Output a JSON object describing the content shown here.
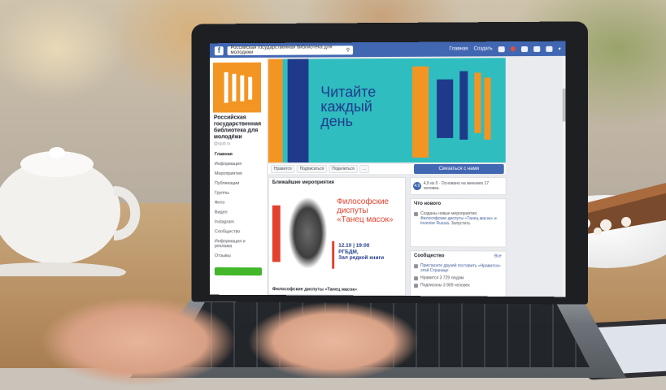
{
  "topbar": {
    "page_search": "Российская государственная библиотека для молодежи",
    "home": "Главная",
    "create": "Создать"
  },
  "sidebar": {
    "page_name": "Российская государственная библиотека для молодёжи",
    "handle": "@rgub.ru",
    "items": [
      "Главная",
      "Информация",
      "Мероприятия",
      "Публикации",
      "Группы",
      "Фото",
      "Видео",
      "Instagram",
      "Сообщество",
      "Информация и реклама",
      "Отзывы"
    ]
  },
  "cover": {
    "text_line1": "Читайте",
    "text_line2": "каждый",
    "text_line3": "день"
  },
  "cover_actions": {
    "like": "Нравится",
    "follow": "Подписаться",
    "share": "Поделиться",
    "more": "...",
    "message": "Связаться с нами"
  },
  "events": {
    "heading": "Ближайшие мероприятия",
    "poster_title_1": "Философские",
    "poster_title_2": "диспуты",
    "poster_title_3": "«Танец масок»",
    "poster_date": "12.10 | 19:00",
    "poster_org": "РГБДМ,",
    "poster_hall": "Зал редкой книги",
    "footer": "Философские диспуты «Танец масок»"
  },
  "rating": {
    "score": "4.9",
    "text": "4,9 из 5 · Основано на мнениях 17 человек."
  },
  "news": {
    "heading": "Что нового",
    "text_prefix": "Созданы новые мероприятия:",
    "text_link": "Философские диспуты «Танец масок» и Inventor Russia.",
    "text_suffix": "Запустить"
  },
  "community": {
    "heading": "Сообщество",
    "all": "Все",
    "invite": "Пригласите друзей поставить «Нравится» этой Странице",
    "likes": "Нравится 3 729 людям",
    "followers": "Подписаны 3 909 человек"
  },
  "colors": {
    "fb_blue": "#4267b2",
    "cover_teal": "#2fbdc0",
    "orange": "#f39523",
    "navy": "#1f3a8a",
    "poster_red": "#e3412e"
  }
}
